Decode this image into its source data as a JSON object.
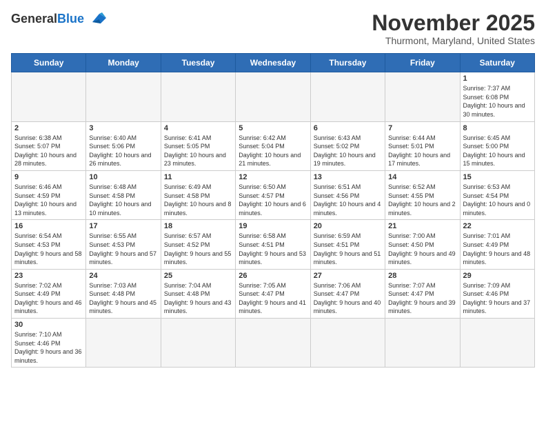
{
  "logo": {
    "text1": "General",
    "text2": "Blue"
  },
  "title": "November 2025",
  "subtitle": "Thurmont, Maryland, United States",
  "days_of_week": [
    "Sunday",
    "Monday",
    "Tuesday",
    "Wednesday",
    "Thursday",
    "Friday",
    "Saturday"
  ],
  "weeks": [
    [
      {
        "day": "",
        "empty": true
      },
      {
        "day": "",
        "empty": true
      },
      {
        "day": "",
        "empty": true
      },
      {
        "day": "",
        "empty": true
      },
      {
        "day": "",
        "empty": true
      },
      {
        "day": "",
        "empty": true
      },
      {
        "day": "1",
        "info": "Sunrise: 7:37 AM\nSunset: 6:08 PM\nDaylight: 10 hours and 30 minutes."
      }
    ],
    [
      {
        "day": "2",
        "info": "Sunrise: 6:38 AM\nSunset: 5:07 PM\nDaylight: 10 hours and 28 minutes."
      },
      {
        "day": "3",
        "info": "Sunrise: 6:40 AM\nSunset: 5:06 PM\nDaylight: 10 hours and 26 minutes."
      },
      {
        "day": "4",
        "info": "Sunrise: 6:41 AM\nSunset: 5:05 PM\nDaylight: 10 hours and 23 minutes."
      },
      {
        "day": "5",
        "info": "Sunrise: 6:42 AM\nSunset: 5:04 PM\nDaylight: 10 hours and 21 minutes."
      },
      {
        "day": "6",
        "info": "Sunrise: 6:43 AM\nSunset: 5:02 PM\nDaylight: 10 hours and 19 minutes."
      },
      {
        "day": "7",
        "info": "Sunrise: 6:44 AM\nSunset: 5:01 PM\nDaylight: 10 hours and 17 minutes."
      },
      {
        "day": "8",
        "info": "Sunrise: 6:45 AM\nSunset: 5:00 PM\nDaylight: 10 hours and 15 minutes."
      }
    ],
    [
      {
        "day": "9",
        "info": "Sunrise: 6:46 AM\nSunset: 4:59 PM\nDaylight: 10 hours and 13 minutes."
      },
      {
        "day": "10",
        "info": "Sunrise: 6:48 AM\nSunset: 4:58 PM\nDaylight: 10 hours and 10 minutes."
      },
      {
        "day": "11",
        "info": "Sunrise: 6:49 AM\nSunset: 4:58 PM\nDaylight: 10 hours and 8 minutes."
      },
      {
        "day": "12",
        "info": "Sunrise: 6:50 AM\nSunset: 4:57 PM\nDaylight: 10 hours and 6 minutes."
      },
      {
        "day": "13",
        "info": "Sunrise: 6:51 AM\nSunset: 4:56 PM\nDaylight: 10 hours and 4 minutes."
      },
      {
        "day": "14",
        "info": "Sunrise: 6:52 AM\nSunset: 4:55 PM\nDaylight: 10 hours and 2 minutes."
      },
      {
        "day": "15",
        "info": "Sunrise: 6:53 AM\nSunset: 4:54 PM\nDaylight: 10 hours and 0 minutes."
      }
    ],
    [
      {
        "day": "16",
        "info": "Sunrise: 6:54 AM\nSunset: 4:53 PM\nDaylight: 9 hours and 58 minutes."
      },
      {
        "day": "17",
        "info": "Sunrise: 6:55 AM\nSunset: 4:53 PM\nDaylight: 9 hours and 57 minutes."
      },
      {
        "day": "18",
        "info": "Sunrise: 6:57 AM\nSunset: 4:52 PM\nDaylight: 9 hours and 55 minutes."
      },
      {
        "day": "19",
        "info": "Sunrise: 6:58 AM\nSunset: 4:51 PM\nDaylight: 9 hours and 53 minutes."
      },
      {
        "day": "20",
        "info": "Sunrise: 6:59 AM\nSunset: 4:51 PM\nDaylight: 9 hours and 51 minutes."
      },
      {
        "day": "21",
        "info": "Sunrise: 7:00 AM\nSunset: 4:50 PM\nDaylight: 9 hours and 49 minutes."
      },
      {
        "day": "22",
        "info": "Sunrise: 7:01 AM\nSunset: 4:49 PM\nDaylight: 9 hours and 48 minutes."
      }
    ],
    [
      {
        "day": "23",
        "info": "Sunrise: 7:02 AM\nSunset: 4:49 PM\nDaylight: 9 hours and 46 minutes."
      },
      {
        "day": "24",
        "info": "Sunrise: 7:03 AM\nSunset: 4:48 PM\nDaylight: 9 hours and 45 minutes."
      },
      {
        "day": "25",
        "info": "Sunrise: 7:04 AM\nSunset: 4:48 PM\nDaylight: 9 hours and 43 minutes."
      },
      {
        "day": "26",
        "info": "Sunrise: 7:05 AM\nSunset: 4:47 PM\nDaylight: 9 hours and 41 minutes."
      },
      {
        "day": "27",
        "info": "Sunrise: 7:06 AM\nSunset: 4:47 PM\nDaylight: 9 hours and 40 minutes."
      },
      {
        "day": "28",
        "info": "Sunrise: 7:07 AM\nSunset: 4:47 PM\nDaylight: 9 hours and 39 minutes."
      },
      {
        "day": "29",
        "info": "Sunrise: 7:09 AM\nSunset: 4:46 PM\nDaylight: 9 hours and 37 minutes."
      }
    ],
    [
      {
        "day": "30",
        "info": "Sunrise: 7:10 AM\nSunset: 4:46 PM\nDaylight: 9 hours and 36 minutes."
      },
      {
        "day": "",
        "empty": true
      },
      {
        "day": "",
        "empty": true
      },
      {
        "day": "",
        "empty": true
      },
      {
        "day": "",
        "empty": true
      },
      {
        "day": "",
        "empty": true
      },
      {
        "day": "",
        "empty": true
      }
    ]
  ]
}
